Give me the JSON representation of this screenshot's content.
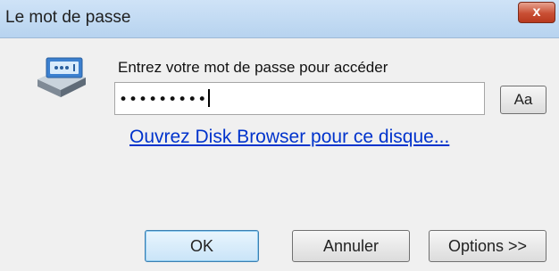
{
  "window": {
    "title": "Le mot de passe",
    "close_label": "x"
  },
  "icon": "disk-lock-icon",
  "prompt": "Entrez votre mot de passe pour accéder",
  "password": {
    "value": "•••••••••"
  },
  "aa_label": "Aa",
  "link": "Ouvrez Disk Browser pour ce disque...",
  "buttons": {
    "ok": "OK",
    "cancel": "Annuler",
    "options": "Options  >>"
  },
  "colors": {
    "titlebar": "#c4dcf4",
    "link": "#0033cc",
    "close": "#c94f34"
  }
}
